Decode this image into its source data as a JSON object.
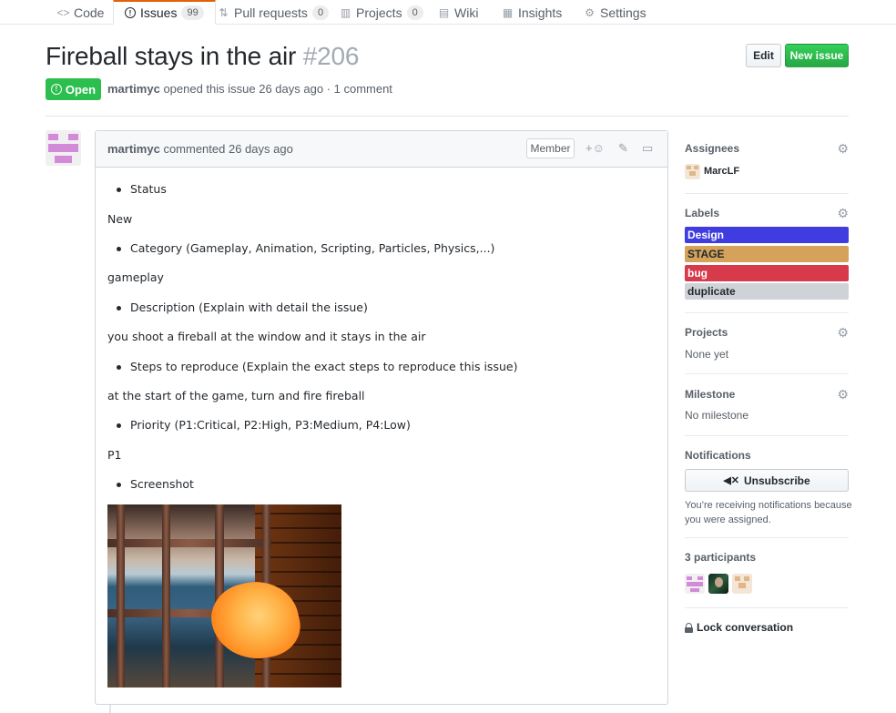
{
  "tabs": [
    {
      "label": "Code",
      "icon": "code-icon"
    },
    {
      "label": "Issues",
      "count": "99",
      "icon": "issue-opened-icon",
      "selected": true
    },
    {
      "label": "Pull requests",
      "count": "0",
      "icon": "git-pull-request-icon"
    },
    {
      "label": "Projects",
      "count": "0",
      "icon": "project-icon"
    },
    {
      "label": "Wiki",
      "icon": "book-icon"
    },
    {
      "label": "Insights",
      "icon": "graph-icon"
    },
    {
      "label": "Settings",
      "icon": "gear-icon"
    }
  ],
  "issue": {
    "title": "Fireball stays in the air",
    "number": "#206",
    "state": "Open",
    "author": "martimyc",
    "meta_rest": "opened this issue 26 days ago · 1 comment"
  },
  "buttons": {
    "edit": "Edit",
    "new_issue": "New issue"
  },
  "comment": {
    "author": "martimyc",
    "time": "commented 26 days ago",
    "role": "Member",
    "body": [
      {
        "type": "bullet",
        "text": "Status"
      },
      {
        "type": "para",
        "text": "New"
      },
      {
        "type": "bullet",
        "text": "Category (Gameplay, Animation, Scripting, Particles, Physics,...)"
      },
      {
        "type": "para",
        "text": "gameplay"
      },
      {
        "type": "bullet",
        "text": "Description (Explain with detail the issue)"
      },
      {
        "type": "para",
        "text": "you shoot a fireball at the window and it stays in the air"
      },
      {
        "type": "bullet",
        "text": "Steps to reproduce (Explain the exact steps to reproduce this issue)"
      },
      {
        "type": "para",
        "text": "at the start of the game, turn and fire fireball"
      },
      {
        "type": "bullet",
        "text": "Priority (P1:Critical, P2:High, P3:Medium, P4:Low)"
      },
      {
        "type": "para",
        "text": "P1"
      },
      {
        "type": "bullet",
        "text": "Screenshot"
      }
    ]
  },
  "sidebar": {
    "assignees": {
      "title": "Assignees",
      "user": "MarcLF"
    },
    "labels": {
      "title": "Labels",
      "items": [
        {
          "name": "Design",
          "color": "#3f3de0",
          "text_color": "#ffffff"
        },
        {
          "name": "STAGE",
          "color": "#d4a25b",
          "text_color": "#24292e"
        },
        {
          "name": "bug",
          "color": "#d73a4a",
          "text_color": "#ffffff"
        },
        {
          "name": "duplicate",
          "color": "#cfd3d7",
          "text_color": "#24292e"
        }
      ]
    },
    "projects": {
      "title": "Projects",
      "value": "None yet"
    },
    "milestone": {
      "title": "Milestone",
      "value": "No milestone"
    },
    "notifications": {
      "title": "Notifications",
      "button": "Unsubscribe",
      "note_line1": "You’re receiving notifications because",
      "note_line2": "you were assigned."
    },
    "participants": {
      "title": "3 participants"
    },
    "lock": "Lock conversation"
  },
  "colors": {
    "open_green": "#2cbe4e",
    "accent_orange": "#e36209"
  }
}
